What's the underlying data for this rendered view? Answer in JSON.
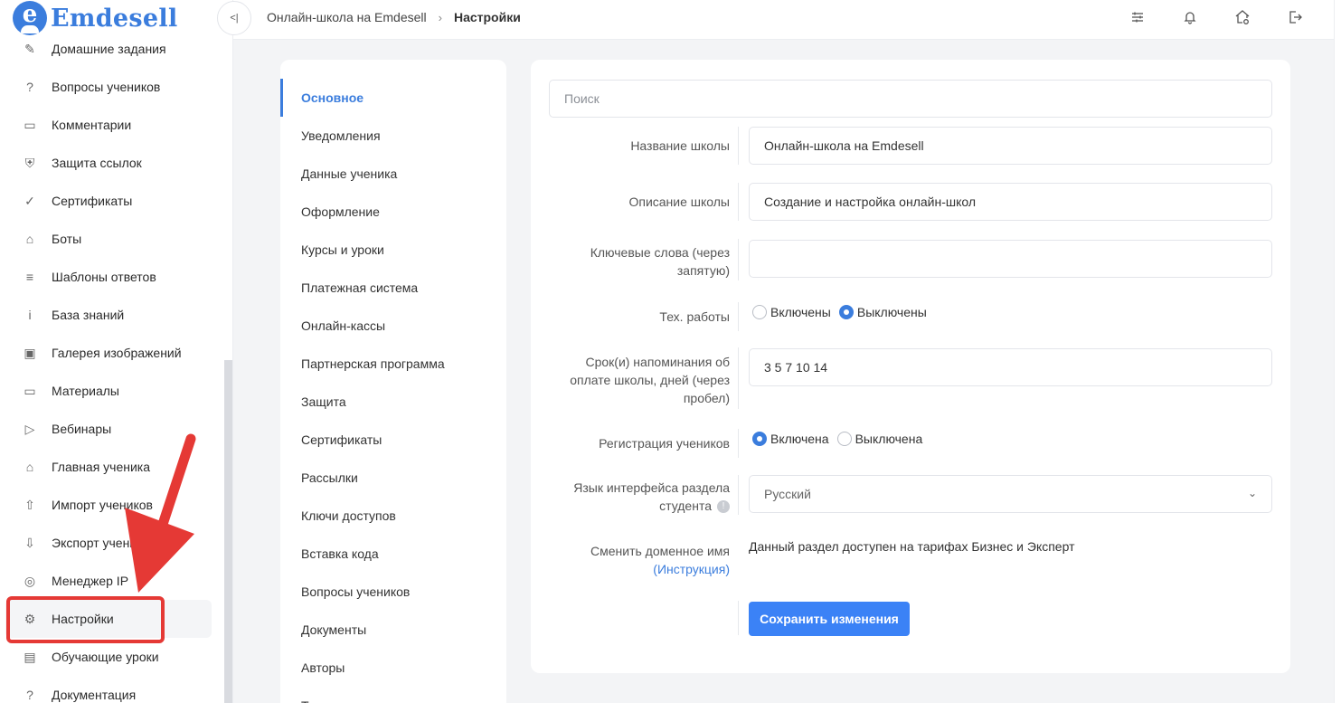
{
  "brand": {
    "logo_letter": "e",
    "name": "Emdesell"
  },
  "sidebar": {
    "items": [
      {
        "label": "Домашние задания",
        "icon": "pencil-icon"
      },
      {
        "label": "Вопросы учеников",
        "icon": "question-circle-icon"
      },
      {
        "label": "Комментарии",
        "icon": "comment-icon"
      },
      {
        "label": "Защита ссылок",
        "icon": "shield-icon"
      },
      {
        "label": "Сертификаты",
        "icon": "badge-check-icon"
      },
      {
        "label": "Боты",
        "icon": "robot-icon"
      },
      {
        "label": "Шаблоны ответов",
        "icon": "list-icon"
      },
      {
        "label": "База знаний",
        "icon": "info-circle-icon"
      },
      {
        "label": "Галерея изображений",
        "icon": "image-icon"
      },
      {
        "label": "Материалы",
        "icon": "briefcase-icon"
      },
      {
        "label": "Вебинары",
        "icon": "play-icon"
      },
      {
        "label": "Главная ученика",
        "icon": "home-icon"
      },
      {
        "label": "Импорт учеников",
        "icon": "upload-icon"
      },
      {
        "label": "Экспорт учеников",
        "icon": "download-icon"
      },
      {
        "label": "Менеджер IP",
        "icon": "target-icon"
      },
      {
        "label": "Настройки",
        "icon": "gear-icon"
      },
      {
        "label": "Обучающие уроки",
        "icon": "film-icon"
      },
      {
        "label": "Документация",
        "icon": "question-square-icon"
      }
    ],
    "active_index": 15
  },
  "header": {
    "breadcrumb": [
      "Онлайн-школа на Emdesell",
      "Настройки"
    ],
    "collapse_glyph": "<|"
  },
  "settings_nav": {
    "items": [
      "Основное",
      "Уведомления",
      "Данные ученика",
      "Оформление",
      "Курсы и уроки",
      "Платежная система",
      "Онлайн-кассы",
      "Партнерская программа",
      "Защита",
      "Сертификаты",
      "Рассылки",
      "Ключи доступов",
      "Вставка кода",
      "Вопросы учеников",
      "Документы",
      "Авторы",
      "Те"
    ],
    "active_index": 0
  },
  "form": {
    "search_placeholder": "Поиск",
    "school_name": {
      "label": "Название школы",
      "value": "Онлайн-школа на Emdesell"
    },
    "school_description": {
      "label": "Описание школы",
      "value": "Создание и настройка онлайн-школ"
    },
    "keywords": {
      "label": "Ключевые слова (через запятую)",
      "value": ""
    },
    "maintenance": {
      "label": "Тех. работы",
      "options": [
        "Включены",
        "Выключены"
      ],
      "selected": 1
    },
    "reminder_days": {
      "label": "Срок(и) напоминания об оплате школы, дней (через пробел)",
      "value": "3 5 7 10 14"
    },
    "registration": {
      "label": "Регистрация учеников",
      "options": [
        "Включена",
        "Выключена"
      ],
      "selected": 0
    },
    "language": {
      "label": "Язык интерфейса раздела студента",
      "info": "!",
      "value": "Русский"
    },
    "domain": {
      "label": "Сменить доменное имя",
      "link": "(Инструкция)",
      "text": "Данный раздел доступен на тарифах Бизнес и Эксперт"
    },
    "save_label": "Сохранить изменения"
  },
  "colors": {
    "accent": "#3b7ddd",
    "button": "#3b82f6",
    "annotation": "#e53935"
  }
}
